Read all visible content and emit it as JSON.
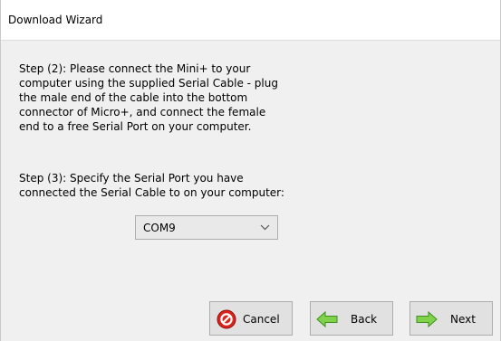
{
  "window": {
    "title": "Download Wizard"
  },
  "instructions": {
    "step2": "Step (2): Please connect the Mini+ to your\ncomputer using the supplied Serial Cable - plug\nthe male end of the cable into the bottom\nconnector of Micro+, and connect the female\nend to a free Serial Port on your computer.",
    "step3": "Step (3): Specify the Serial Port you have\nconnected the Serial Cable to on your computer:"
  },
  "serial_port": {
    "selected": "COM9",
    "arrow_icon": "chevron-down-icon"
  },
  "buttons": {
    "cancel": {
      "label": "Cancel",
      "icon": "cancel-icon",
      "color": "#d9251d"
    },
    "back": {
      "label": "Back",
      "icon": "arrow-left-icon",
      "color": "#7fd24a"
    },
    "next": {
      "label": "Next",
      "icon": "arrow-right-icon",
      "color": "#7fd24a"
    }
  }
}
